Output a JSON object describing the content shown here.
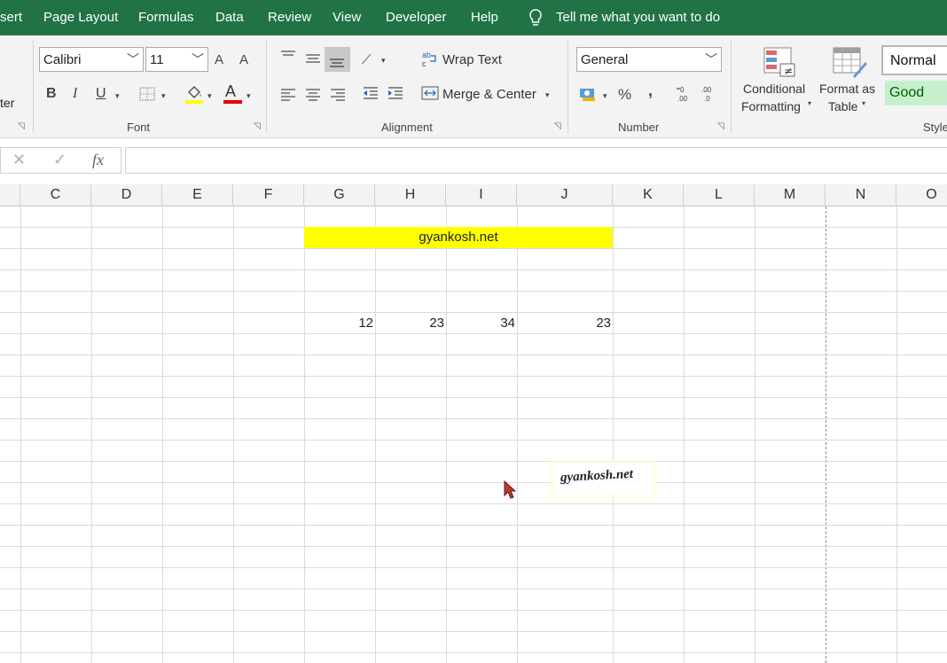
{
  "tabs": [
    "sert",
    "Page Layout",
    "Formulas",
    "Data",
    "Review",
    "View",
    "Developer",
    "Help"
  ],
  "tell_me": "Tell me what you want to do",
  "ribbon": {
    "clipboard_partial": "ter",
    "font": {
      "font_name": "Calibri",
      "font_size": "11",
      "grow_label": "A",
      "shrink_label": "A",
      "bold": "B",
      "italic": "I",
      "underline": "U",
      "font_color_label": "A",
      "group_label": "Font",
      "fill_color": "#ffff00",
      "font_color": "#e60000"
    },
    "alignment": {
      "wrap_text": "Wrap Text",
      "merge_center": "Merge & Center",
      "group_label": "Alignment"
    },
    "number": {
      "format": "General",
      "percent": "%",
      "comma": ",",
      "group_label": "Number"
    },
    "styles": {
      "conditional_line1": "Conditional",
      "conditional_line2": "Formatting",
      "format_table_line1": "Format as",
      "format_table_line2": "Table",
      "normal": "Normal",
      "good": "Good",
      "group_label": "Style"
    }
  },
  "formula_bar": {
    "fx": "fx",
    "value": ""
  },
  "columns": [
    "C",
    "D",
    "E",
    "F",
    "G",
    "H",
    "I",
    "J",
    "K",
    "L",
    "M",
    "N",
    "O"
  ],
  "cells": {
    "merged_title": "gyankosh.net",
    "g5": "12",
    "h5": "23",
    "i5": "34",
    "j5": "23"
  },
  "watermark": "gyankosh.net",
  "colors": {
    "ribbon_green": "#217346",
    "highlight_yellow": "#ffff00",
    "good_fill": "#c6efce",
    "good_text": "#006100"
  }
}
